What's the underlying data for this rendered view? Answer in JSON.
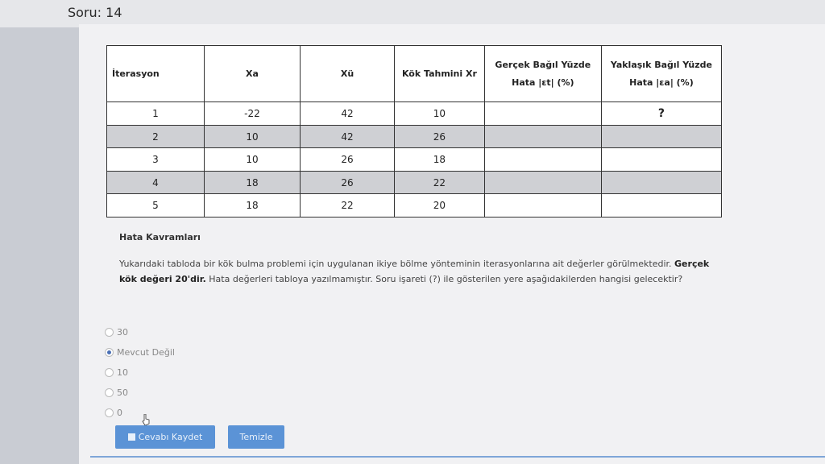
{
  "header": {
    "title": "Soru: 14"
  },
  "table": {
    "headers": {
      "iter": "İterasyon",
      "xa": "Xa",
      "xu": "Xü",
      "xr": "Kök Tahmini Xr",
      "et_line1": "Gerçek Bağıl Yüzde",
      "et_line2": "Hata |εt| (%)",
      "ea_line1": "Yaklaşık Bağıl Yüzde",
      "ea_line2": "Hata |εa| (%)"
    },
    "rows": [
      {
        "iter": "1",
        "xa": "-22",
        "xu": "42",
        "xr": "10",
        "et": "",
        "ea": "?"
      },
      {
        "iter": "2",
        "xa": "10",
        "xu": "42",
        "xr": "26",
        "et": "",
        "ea": ""
      },
      {
        "iter": "3",
        "xa": "10",
        "xu": "26",
        "xr": "18",
        "et": "",
        "ea": ""
      },
      {
        "iter": "4",
        "xa": "18",
        "xu": "26",
        "xr": "22",
        "et": "",
        "ea": ""
      },
      {
        "iter": "5",
        "xa": "18",
        "xu": "22",
        "xr": "20",
        "et": "",
        "ea": ""
      }
    ]
  },
  "section_title": "Hata Kavramları",
  "question": {
    "part1": "Yukarıdaki tabloda bir kök bulma problemi için uygulanan ikiye bölme yönteminin iterasyonlarına ait değerler görülmektedir. ",
    "bold": "Gerçek kök değeri 20'dir.",
    "part2": " Hata değerleri tabloya yazılmamıştır. Soru işareti (?) ile gösterilen yere aşağıdakilerden hangisi gelecektir?"
  },
  "options": [
    {
      "label": "30",
      "selected": false
    },
    {
      "label": "Mevcut Değil",
      "selected": true
    },
    {
      "label": "10",
      "selected": false
    },
    {
      "label": "50",
      "selected": false
    },
    {
      "label": "0",
      "selected": false
    }
  ],
  "buttons": {
    "save": "Cevabı Kaydet",
    "clear": "Temizle"
  },
  "colors": {
    "button": "#5b93d6",
    "shaded_row": "#cfd0d4"
  }
}
